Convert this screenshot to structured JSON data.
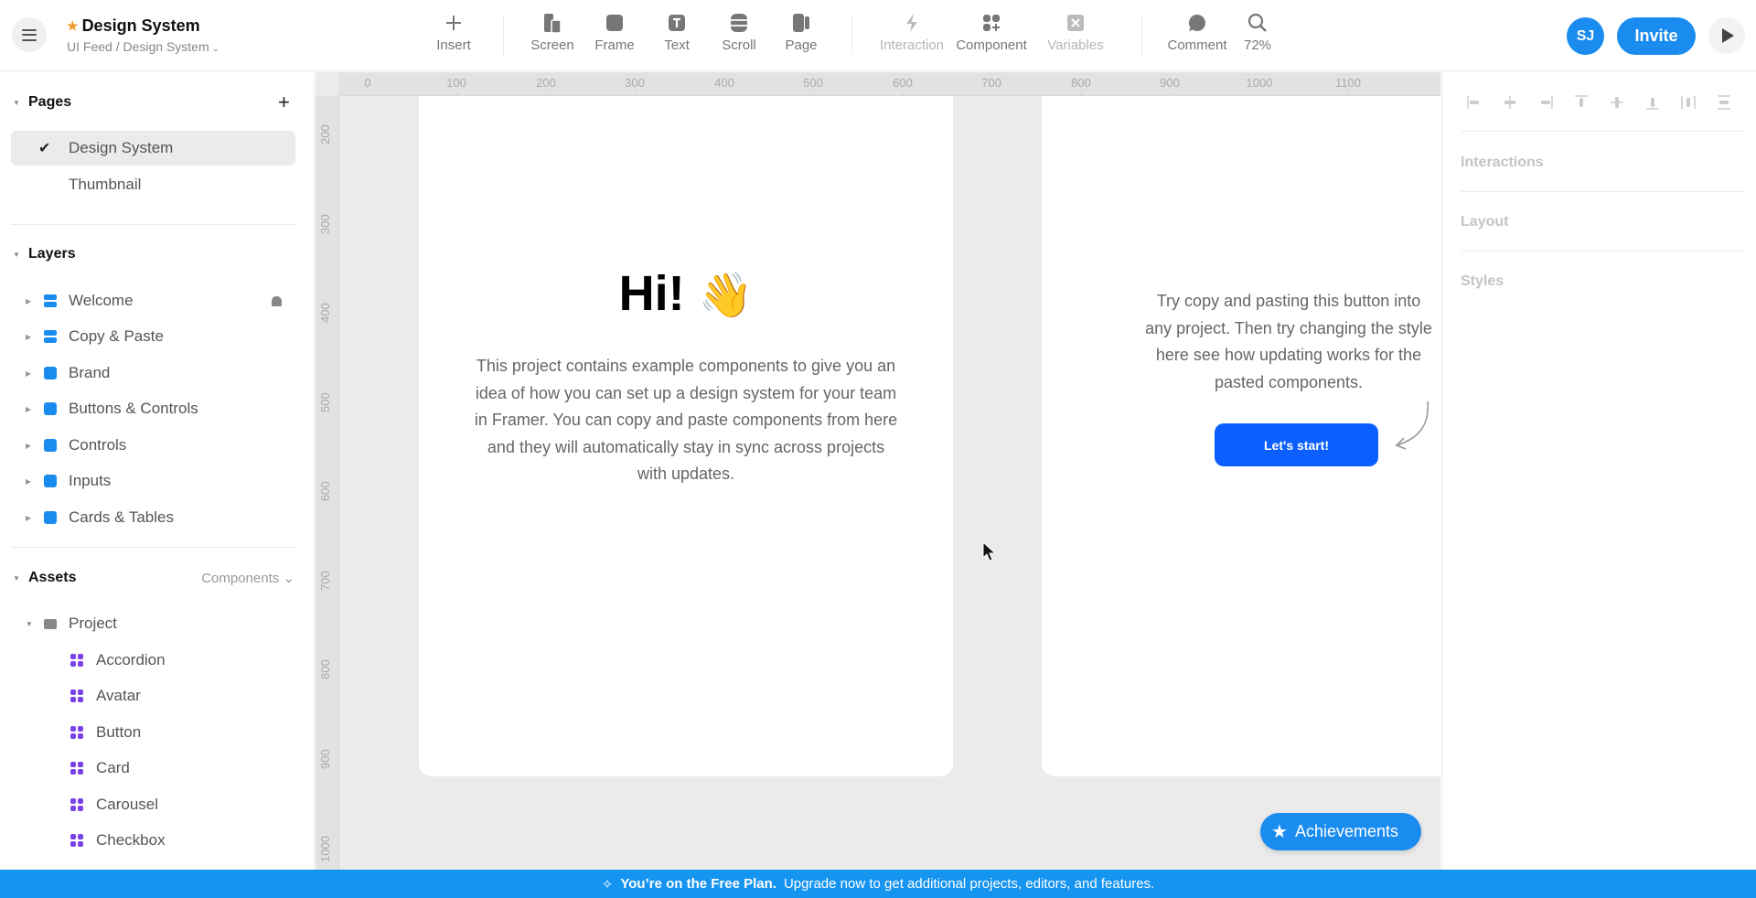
{
  "header": {
    "project_title": "Design System",
    "breadcrumb": "UI Feed / Design System",
    "favorite_icon": "star-icon",
    "menu_icon": "hamburger-icon"
  },
  "toolbar": {
    "insert": {
      "label": "Insert",
      "icon": "plus-icon"
    },
    "screen": {
      "label": "Screen",
      "icon": "screen-icon"
    },
    "frame": {
      "label": "Frame",
      "icon": "frame-icon"
    },
    "text": {
      "label": "Text",
      "icon": "text-icon"
    },
    "scroll": {
      "label": "Scroll",
      "icon": "scroll-icon"
    },
    "page": {
      "label": "Page",
      "icon": "page-icon"
    },
    "interaction": {
      "label": "Interaction",
      "icon": "bolt-icon",
      "disabled": true
    },
    "component": {
      "label": "Component",
      "icon": "component-icon"
    },
    "variables": {
      "label": "Variables",
      "icon": "variables-icon",
      "disabled": true
    },
    "comment": {
      "label": "Comment",
      "icon": "comment-icon"
    },
    "zoom": {
      "label": "72%",
      "icon": "search-icon"
    }
  },
  "user": {
    "initials": "SJ",
    "invite_label": "Invite",
    "preview_icon": "play-icon"
  },
  "colors": {
    "accent": "#1a8cf0",
    "button_blue": "#0b5fff",
    "component_purple": "#7a43e8"
  },
  "sidebar": {
    "pages": {
      "title": "Pages",
      "items": [
        {
          "label": "Design System",
          "selected": true
        },
        {
          "label": "Thumbnail",
          "selected": false
        }
      ]
    },
    "layers": {
      "title": "Layers",
      "items": [
        {
          "label": "Welcome",
          "icon": "stack-icon",
          "locked": true
        },
        {
          "label": "Copy & Paste",
          "icon": "stack-icon"
        },
        {
          "label": "Brand",
          "icon": "frame-icon"
        },
        {
          "label": "Buttons & Controls",
          "icon": "frame-icon"
        },
        {
          "label": "Controls",
          "icon": "frame-icon"
        },
        {
          "label": "Inputs",
          "icon": "frame-icon"
        },
        {
          "label": "Cards & Tables",
          "icon": "frame-icon"
        }
      ]
    },
    "assets": {
      "title": "Assets",
      "filter": "Components",
      "folder": "Project",
      "items": [
        "Accordion",
        "Avatar",
        "Button",
        "Card",
        "Carousel",
        "Checkbox"
      ]
    }
  },
  "canvas": {
    "ruler_top": [
      "0",
      "100",
      "200",
      "300",
      "400",
      "500",
      "600",
      "700",
      "800",
      "900",
      "1000",
      "1100"
    ],
    "ruler_left": [
      "200",
      "300",
      "400",
      "500",
      "600",
      "700",
      "800",
      "900",
      "1000"
    ],
    "welcome": {
      "heading": "Hi!",
      "emoji": "👋",
      "body": "This project contains example components to give you an idea of how you can set up a design system for your team in Framer. You can copy and paste components from here and they will automatically stay in sync across projects with updates."
    },
    "copy_paste": {
      "lines": [
        "Try copy and pasting this button into",
        "any project. Then try changing the style",
        "here see how updating works for the",
        "pasted components."
      ],
      "button_label": "Let's start!"
    },
    "achievements_label": "Achievements"
  },
  "right_panel": {
    "sections": [
      "Interactions",
      "Layout",
      "Styles"
    ]
  },
  "banner": {
    "bold": "You’re on the Free Plan.",
    "text": "Upgrade now to get additional projects, editors, and features."
  }
}
